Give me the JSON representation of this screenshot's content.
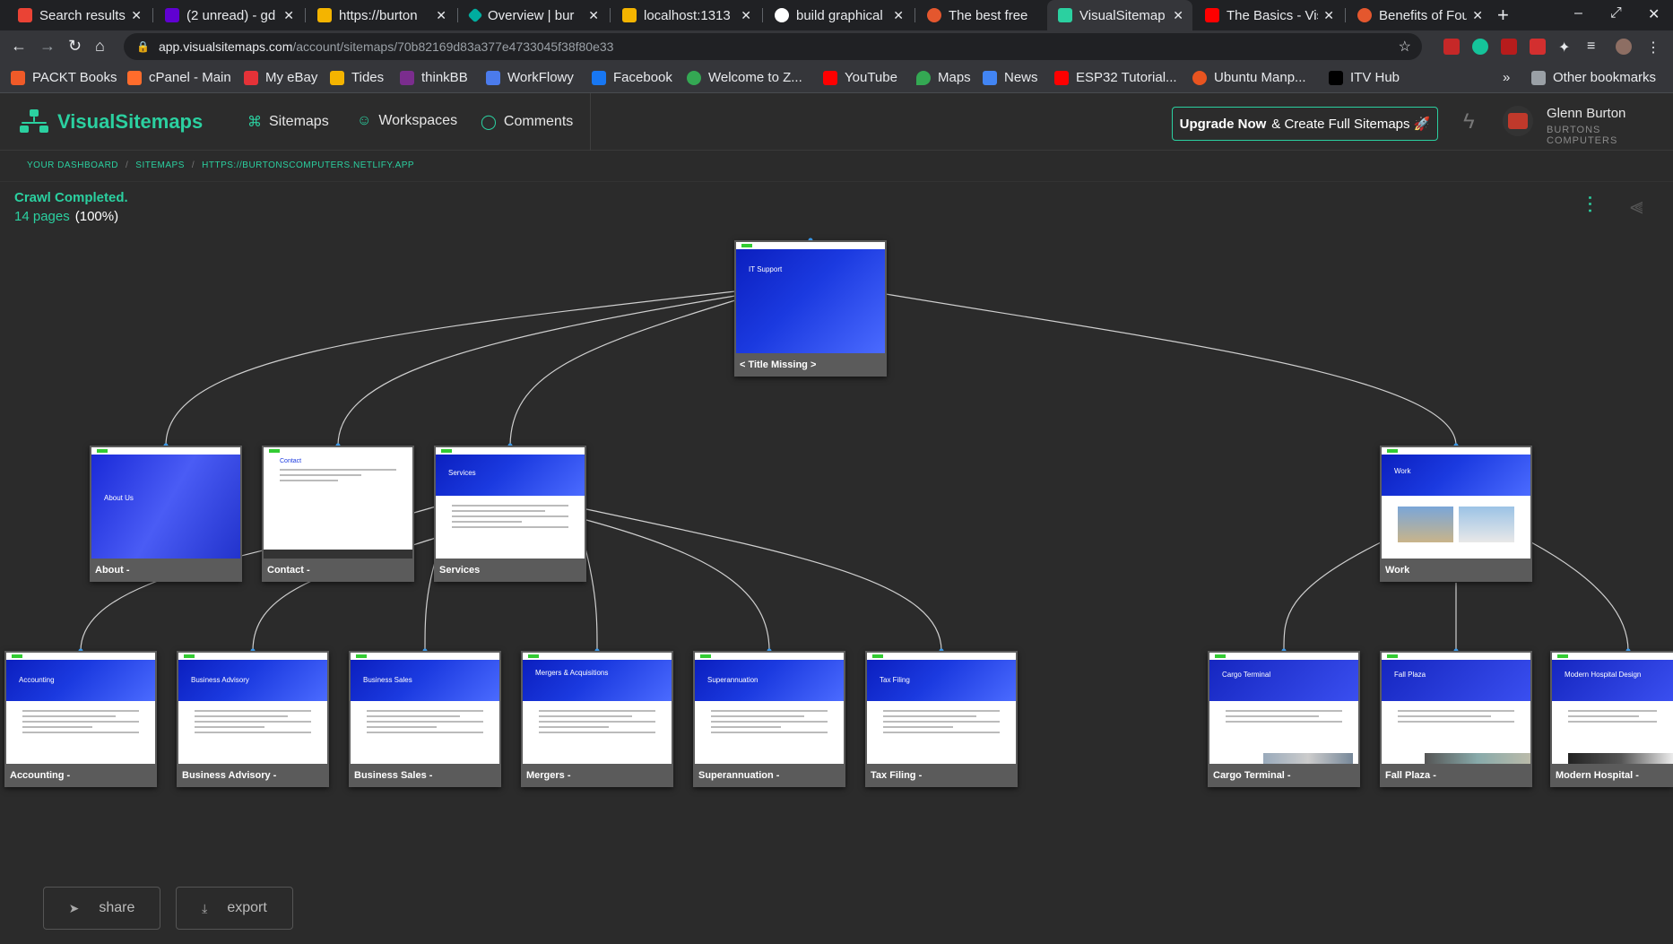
{
  "browser": {
    "tabs": [
      {
        "title": "Search results",
        "color": "#ea4335"
      },
      {
        "title": "(2 unread) - gd",
        "color": "#6001d2"
      },
      {
        "title": "https://burton",
        "color": "#f4b400"
      },
      {
        "title": "Overview | bur",
        "color": "#00ad9f"
      },
      {
        "title": "localhost:1313",
        "color": "#f4b400"
      },
      {
        "title": "build graphical",
        "color": "#ffffff"
      },
      {
        "title": "The best free",
        "color": "#e4572e"
      },
      {
        "title": "VisualSitemap",
        "color": "#2bd0a0"
      },
      {
        "title": "The Basics - Vis",
        "color": "#ff0000"
      },
      {
        "title": "Benefits of Fou",
        "color": "#e4572e"
      }
    ],
    "url_host": "app.visualsitemaps.com",
    "url_path": "/account/sitemaps/70b82169d83a377e4733045f38f80e33",
    "bookmarks": [
      {
        "label": "PACKT Books",
        "color": "#f05a28"
      },
      {
        "label": "cPanel - Main",
        "color": "#ff6c2c"
      },
      {
        "label": "My eBay",
        "color": "#e53238"
      },
      {
        "label": "Tides",
        "color": "#f4b400"
      },
      {
        "label": "thinkBB",
        "color": "#7b2d8e"
      },
      {
        "label": "WorkFlowy",
        "color": "#4b7bec"
      },
      {
        "label": "Facebook",
        "color": "#1877f2"
      },
      {
        "label": "Welcome to Z...",
        "color": "#34a853"
      },
      {
        "label": "YouTube",
        "color": "#ff0000"
      },
      {
        "label": "Maps",
        "color": "#34a853"
      },
      {
        "label": "News",
        "color": "#4285f4"
      },
      {
        "label": "ESP32 Tutorial...",
        "color": "#ff0000"
      },
      {
        "label": "Ubuntu Manp...",
        "color": "#e95420"
      },
      {
        "label": "ITV Hub",
        "color": "#000000"
      }
    ],
    "other_bookmarks": "Other bookmarks"
  },
  "app": {
    "brand": "VisualSitemaps",
    "nav": {
      "sitemaps": "Sitemaps",
      "workspaces": "Workspaces",
      "comments": "Comments"
    },
    "upgrade_bold": "Upgrade Now",
    "upgrade_rest": "& Create Full Sitemaps 🚀",
    "user_name": "Glenn Burton",
    "user_company": "BURTONS COMPUTERS",
    "accent": "#2bd0a0"
  },
  "breadcrumb": [
    "YOUR DASHBOARD",
    "SITEMAPS",
    "HTTPS://BURTONSCOMPUTERS.NETLIFY.APP"
  ],
  "status": {
    "crawl": "Crawl Completed.",
    "pages": "14 pages",
    "percent": "(100%)"
  },
  "nodes": {
    "root": {
      "label": "< Title Missing >",
      "hero": "IT Support"
    },
    "about": {
      "label": "About -",
      "hero": "About Us"
    },
    "contact": {
      "label": "Contact -",
      "hero": "Contact"
    },
    "services": {
      "label": "Services",
      "hero": "Services"
    },
    "work": {
      "label": "Work",
      "hero": "Work"
    },
    "accounting": {
      "label": "Accounting -",
      "hero": "Accounting"
    },
    "business_advisory": {
      "label": "Business Advisory -",
      "hero": "Business Advisory"
    },
    "business_sales": {
      "label": "Business Sales -",
      "hero": "Business Sales"
    },
    "mergers": {
      "label": "Mergers -",
      "hero": "Mergers & Acquisitions"
    },
    "superannuation": {
      "label": "Superannuation -",
      "hero": "Superannuation"
    },
    "tax_filing": {
      "label": "Tax Filing -",
      "hero": "Tax Filing"
    },
    "cargo_terminal": {
      "label": "Cargo Terminal -",
      "hero": "Cargo Terminal"
    },
    "fall_plaza": {
      "label": "Fall Plaza -",
      "hero": "Fall Plaza"
    },
    "modern_hospital": {
      "label": "Modern Hospital -",
      "hero": "Modern Hospital Design"
    }
  },
  "actions": {
    "share": "share",
    "export": "export"
  }
}
